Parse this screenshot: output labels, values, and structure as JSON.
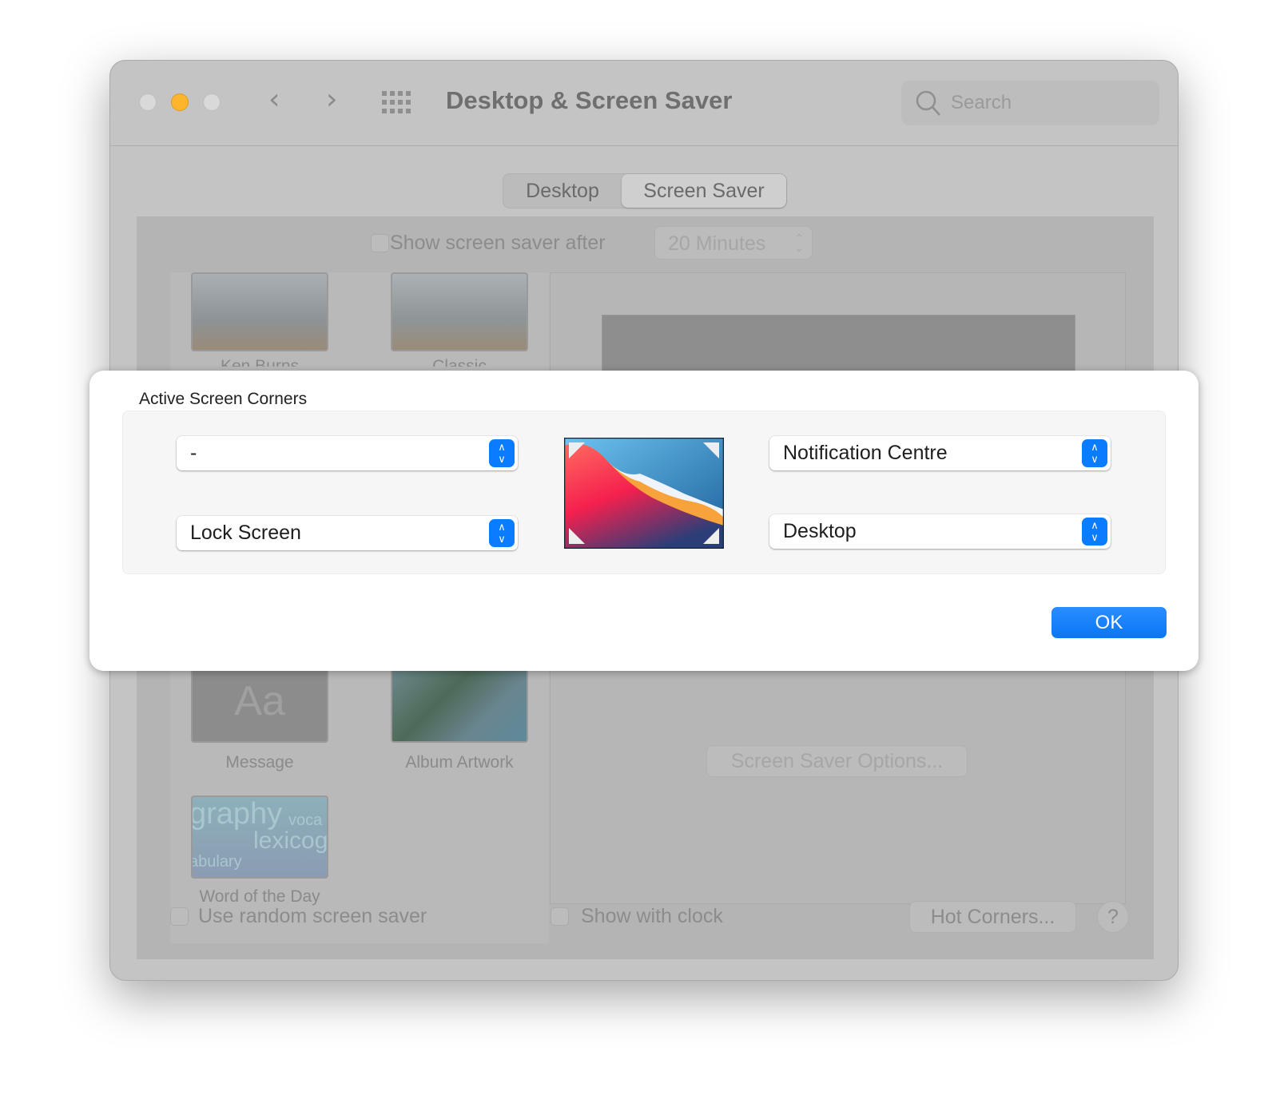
{
  "window": {
    "title": "Desktop & Screen Saver",
    "search_placeholder": "Search",
    "traffic_lights": {
      "close": "#d9d9d9",
      "minimize": "#fdb62c",
      "zoom": "#d9d9d9"
    }
  },
  "tabs": [
    {
      "label": "Desktop",
      "selected": false
    },
    {
      "label": "Screen Saver",
      "selected": true
    }
  ],
  "screen_saver": {
    "show_after_label": "Show screen saver after",
    "show_after_checked": false,
    "show_after_value": "20 Minutes",
    "savers": [
      {
        "label": "Ken Burns"
      },
      {
        "label": "Classic"
      },
      {
        "label": "Message",
        "glyph": "Aa"
      },
      {
        "label": "Album Artwork"
      },
      {
        "label": "Word of the Day",
        "thumb_words": [
          "graphy",
          "voca",
          "lexicog",
          "abulary"
        ]
      }
    ],
    "options_button": "Screen Saver Options...",
    "random_label": "Use random screen saver",
    "random_checked": false,
    "clock_label": "Show with clock",
    "clock_checked": false,
    "hot_corners_button": "Hot Corners...",
    "help_button": "?"
  },
  "dialog": {
    "title": "Active Screen Corners",
    "corners": {
      "top_left": "-",
      "bottom_left": "Lock Screen",
      "top_right": "Notification Centre",
      "bottom_right": "Desktop"
    },
    "ok_label": "OK",
    "accent": "#0a7cff"
  }
}
